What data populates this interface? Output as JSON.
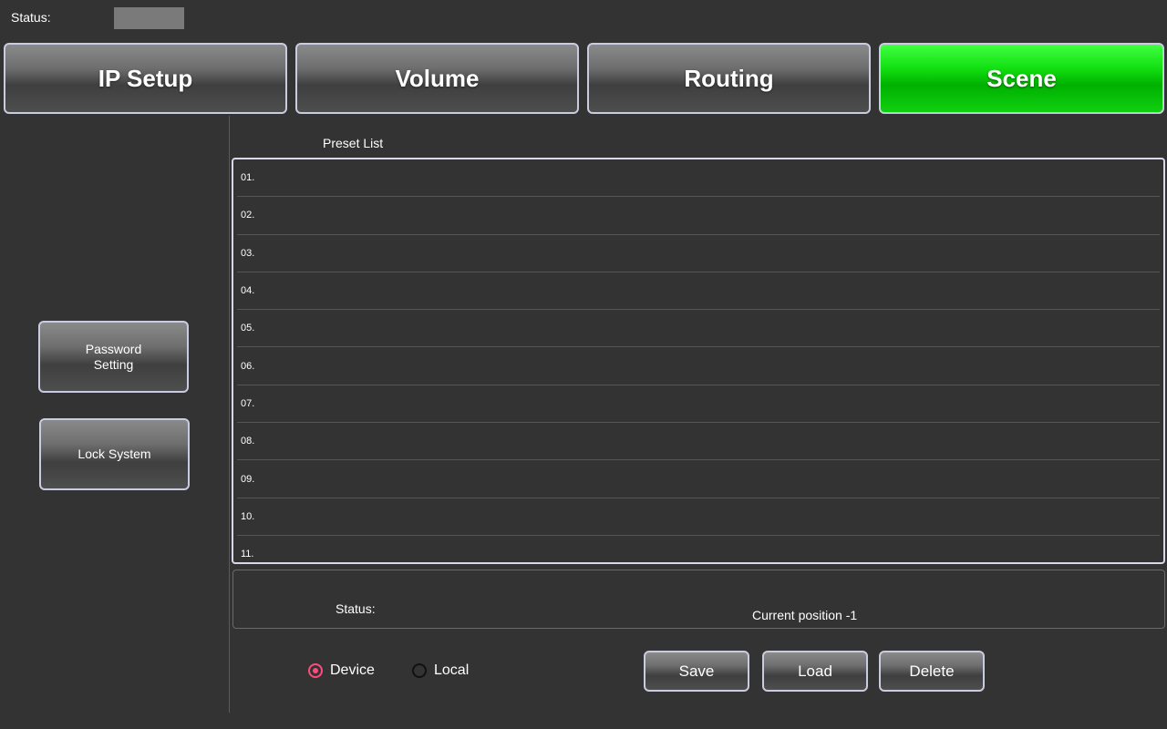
{
  "top_status": {
    "label": "Status:"
  },
  "tabs": [
    {
      "label": "IP Setup",
      "active": false
    },
    {
      "label": "Volume",
      "active": false
    },
    {
      "label": "Routing",
      "active": false
    },
    {
      "label": "Scene",
      "active": true
    }
  ],
  "sidebar": {
    "password_label": "Password\nSetting",
    "lock_label": "Lock System"
  },
  "preset": {
    "title": "Preset List",
    "rows": [
      "01.",
      "02.",
      "03.",
      "04.",
      "05.",
      "06.",
      "07.",
      "08.",
      "09.",
      "10.",
      "11."
    ]
  },
  "status_panel": {
    "label": "Status:",
    "current_position": "Current position  -1"
  },
  "source": {
    "device_label": "Device",
    "local_label": "Local",
    "selected": "Device"
  },
  "actions": {
    "save_label": "Save",
    "load_label": "Load",
    "delete_label": "Delete"
  },
  "colors": {
    "active_tab": "#00d000",
    "radio_accent": "#ff4c7d",
    "background": "#333333"
  }
}
